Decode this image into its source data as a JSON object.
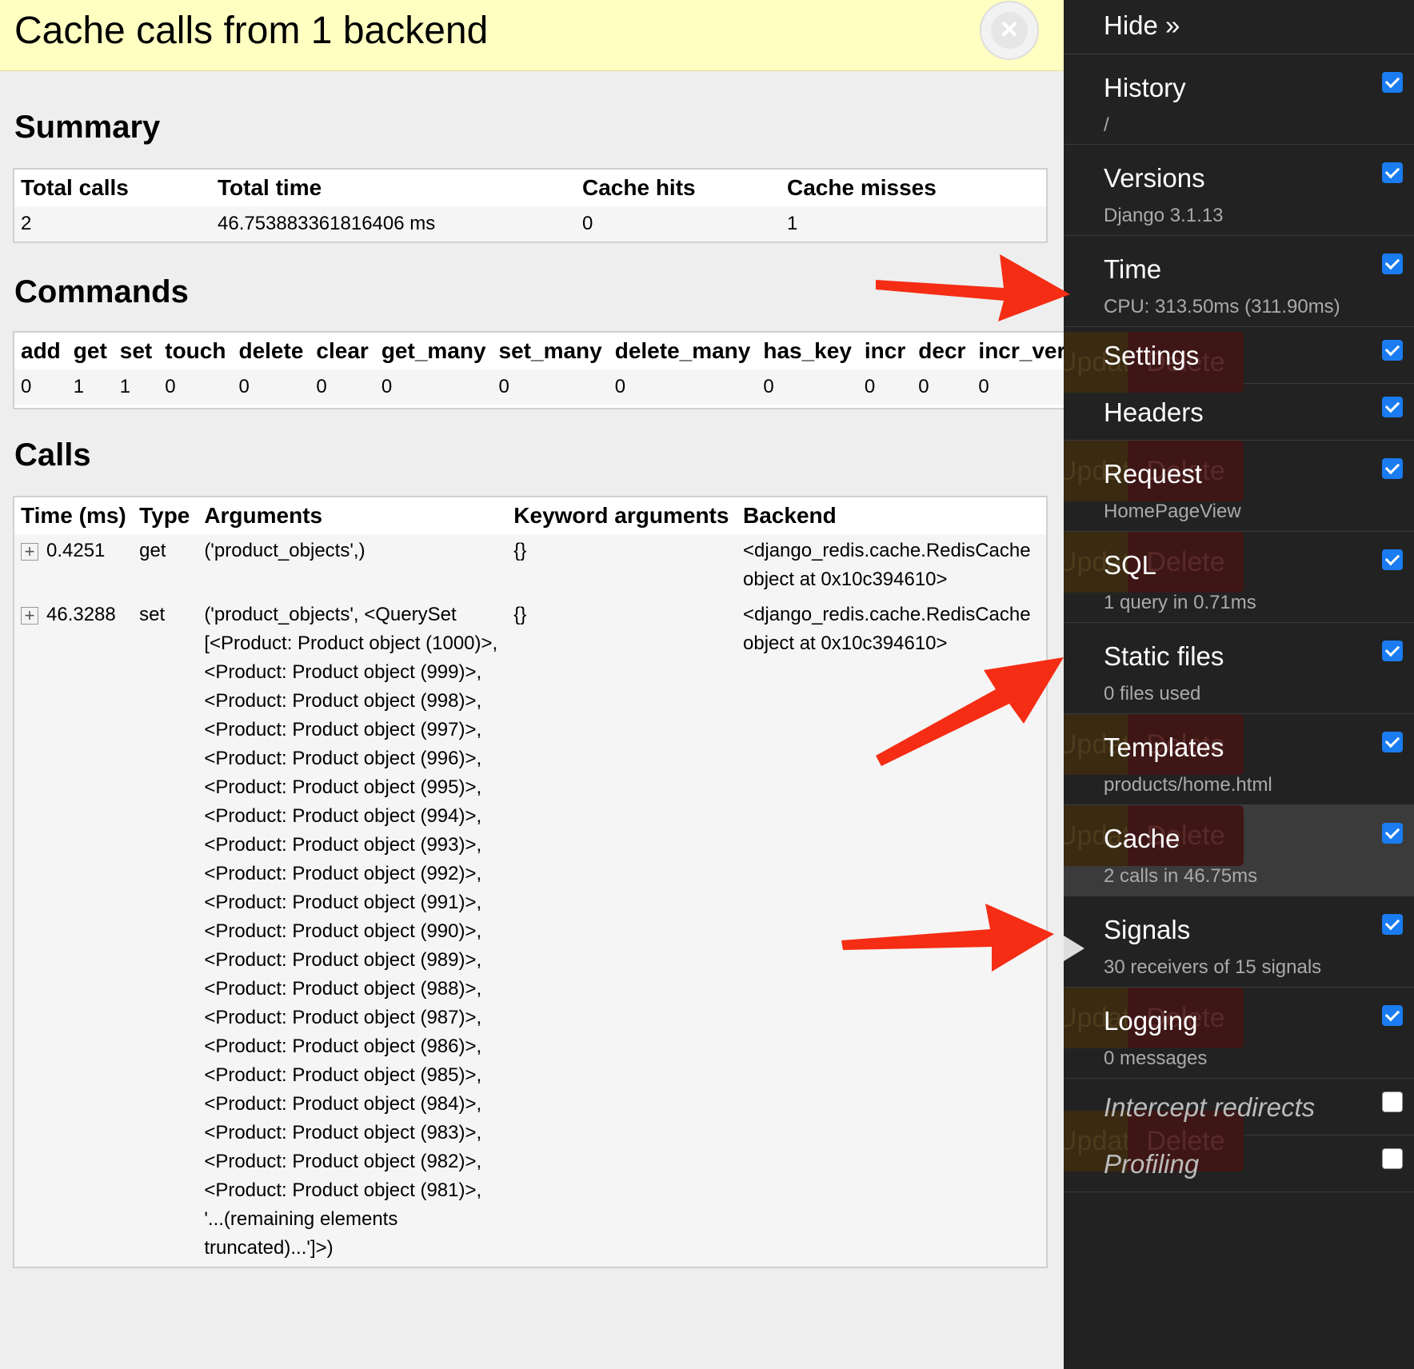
{
  "panel": {
    "title": "Cache calls from 1 backend",
    "close_icon": "×"
  },
  "summary": {
    "heading": "Summary",
    "headers": [
      "Total calls",
      "Total time",
      "Cache hits",
      "Cache misses"
    ],
    "row": [
      "2",
      "46.753883361816406 ms",
      "0",
      "1"
    ]
  },
  "commands": {
    "heading": "Commands",
    "headers": [
      "add",
      "get",
      "set",
      "touch",
      "delete",
      "clear",
      "get_many",
      "set_many",
      "delete_many",
      "has_key",
      "incr",
      "decr",
      "incr_version"
    ],
    "row": [
      "0",
      "1",
      "1",
      "0",
      "0",
      "0",
      "0",
      "0",
      "0",
      "0",
      "0",
      "0",
      "0"
    ]
  },
  "calls": {
    "heading": "Calls",
    "headers": [
      "Time (ms)",
      "Type",
      "Arguments",
      "Keyword arguments",
      "Backend"
    ],
    "toggle_icon": "+",
    "rows": [
      {
        "time": "0.4251",
        "type": "get",
        "arguments": "('product_objects',)",
        "kwargs": "{}",
        "backend": "<django_redis.cache.RedisCache object at 0x10c394610>"
      },
      {
        "time": "46.3288",
        "type": "set",
        "arguments": "('product_objects', <QuerySet [<Product: Product object (1000)>, <Product: Product object (999)>, <Product: Product object (998)>, <Product: Product object (997)>, <Product: Product object (996)>, <Product: Product object (995)>, <Product: Product object (994)>, <Product: Product object (993)>, <Product: Product object (992)>, <Product: Product object (991)>, <Product: Product object (990)>, <Product: Product object (989)>, <Product: Product object (988)>, <Product: Product object (987)>, <Product: Product object (986)>, <Product: Product object (985)>, <Product: Product object (984)>, <Product: Product object (983)>, <Product: Product object (982)>, <Product: Product object (981)>, '...(remaining elements truncated)...']>)",
        "kwargs": "{}",
        "backend": "<django_redis.cache.RedisCache object at 0x10c394610>"
      }
    ]
  },
  "toolbar": {
    "hide_label": "Hide »",
    "items": [
      {
        "title": "History",
        "sub": "/",
        "checked": true
      },
      {
        "title": "Versions",
        "sub": "Django 3.1.13",
        "checked": true
      },
      {
        "title": "Time",
        "sub": "CPU: 313.50ms (311.90ms)",
        "checked": true
      },
      {
        "title": "Settings",
        "sub": "",
        "checked": true
      },
      {
        "title": "Headers",
        "sub": "",
        "checked": true
      },
      {
        "title": "Request",
        "sub": "HomePageView",
        "checked": true
      },
      {
        "title": "SQL",
        "sub": "1 query in 0.71ms",
        "checked": true
      },
      {
        "title": "Static files",
        "sub": "0 files used",
        "checked": true
      },
      {
        "title": "Templates",
        "sub": "products/home.html",
        "checked": true
      },
      {
        "title": "Cache",
        "sub": "2 calls in 46.75ms",
        "checked": true,
        "active": true
      },
      {
        "title": "Signals",
        "sub": "30 receivers of 15 signals",
        "checked": true
      },
      {
        "title": "Logging",
        "sub": "0 messages",
        "checked": true
      },
      {
        "title": "Intercept redirects",
        "sub": "",
        "checked": false
      },
      {
        "title": "Profiling",
        "sub": "",
        "checked": false
      }
    ],
    "ghost_update": "Update",
    "ghost_delete": "Delete"
  },
  "colors": {
    "header_bg": "#ffffc2",
    "toolbar_bg": "#222222",
    "checkbox": "#1a7cf0",
    "annotation_arrow": "#f52d14"
  }
}
